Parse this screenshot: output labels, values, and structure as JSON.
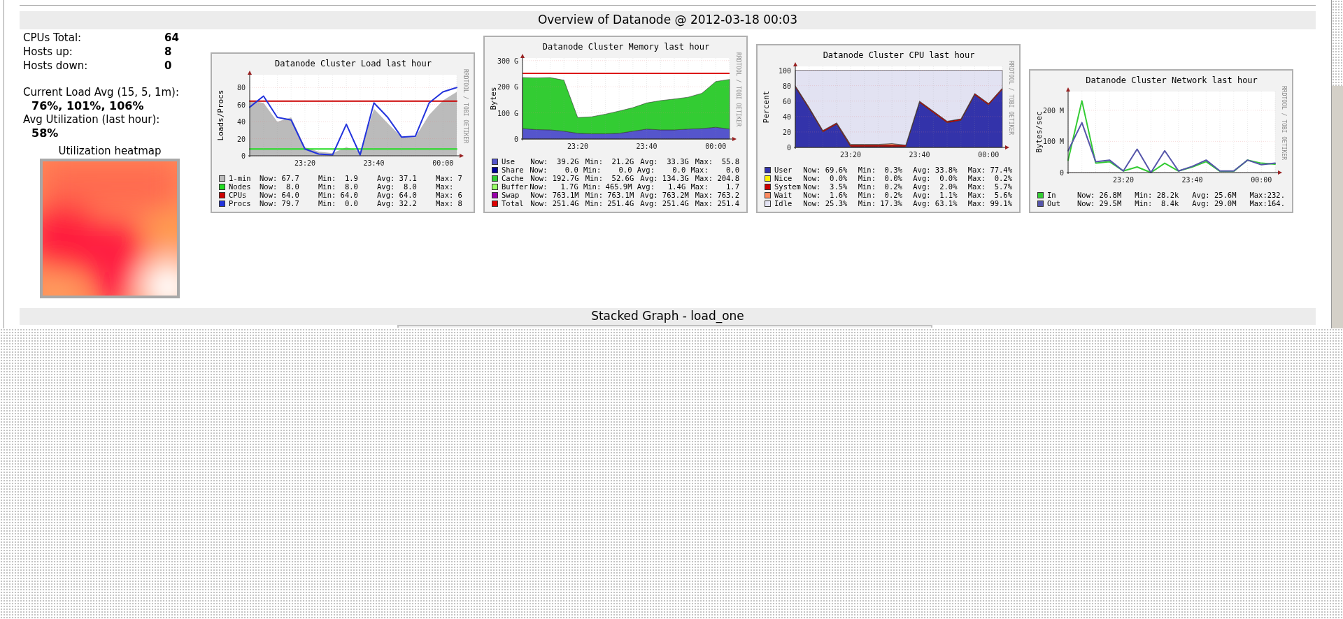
{
  "header": {
    "title": "Overview of Datanode @ 2012-03-18 00:03"
  },
  "summary": {
    "stats": [
      {
        "label": "CPUs Total:",
        "value": "64"
      },
      {
        "label": "Hosts up:",
        "value": "8"
      },
      {
        "label": "Hosts down:",
        "value": "0"
      }
    ],
    "load_avg": {
      "label": "Current Load Avg (15, 5, 1m):",
      "value": "76%, 101%, 106%"
    },
    "utilization": {
      "label": "Avg Utilization (last hour):",
      "value": "58%"
    },
    "heatmap": {
      "title": "Utilization heatmap"
    }
  },
  "charts": [
    {
      "credit": "RRDTOOL / TOBI OETIKER",
      "chart_data": {
        "type": "line",
        "title": "Datanode Cluster Load last hour",
        "ylabel": "Loads/Procs",
        "categories": [
          null,
          null,
          null,
          null,
          "23:20",
          null,
          null,
          null,
          null,
          "23:40",
          null,
          null,
          null,
          null,
          "00:00",
          null
        ],
        "series": [
          {
            "name": "1-min",
            "type": "area",
            "color": "#bbbbbb",
            "values": [
              65,
              62,
              40,
              45,
              10,
              5,
              3,
              10,
              5,
              55,
              38,
              22,
              22,
              48,
              65,
              75
            ]
          },
          {
            "name": "Nodes",
            "type": "line",
            "color": "#22dd22",
            "values": [
              8,
              8,
              8,
              8,
              8,
              8,
              8,
              8,
              8,
              8,
              8,
              8,
              8,
              8,
              8,
              8
            ]
          },
          {
            "name": "CPUs",
            "type": "line",
            "color": "#cc0000",
            "values": [
              64,
              64,
              64,
              64,
              64,
              64,
              64,
              64,
              64,
              64,
              64,
              64,
              64,
              64,
              64,
              64
            ]
          },
          {
            "name": "Procs",
            "type": "line",
            "color": "#2233dd",
            "values": [
              57,
              70,
              45,
              42,
              8,
              2,
              1,
              37,
              1,
              62,
              45,
              22,
              23,
              62,
              75,
              80
            ]
          }
        ],
        "ylim": [
          0,
          95
        ],
        "yticks": [
          0,
          20,
          40,
          60,
          80
        ],
        "grid": true
      },
      "legend": [
        {
          "now": "Now: 67.7",
          "min": "Min:  1.9",
          "avg": "Avg: 37.1",
          "max": "Max: 7"
        },
        {
          "now": "Now:  8.0",
          "min": "Min:  8.0",
          "avg": "Avg:  8.0",
          "max": "Max:"
        },
        {
          "now": "Now: 64.0",
          "min": "Min: 64.0",
          "avg": "Avg: 64.0",
          "max": "Max: 6"
        },
        {
          "now": "Now: 79.7",
          "min": "Min:  0.0",
          "avg": "Avg: 32.2",
          "max": "Max: 8"
        }
      ]
    },
    {
      "credit": "RRDTOOL / TOBI OETIKER",
      "chart_data": {
        "type": "area",
        "stacked": true,
        "title": "Datanode Cluster Memory last hour",
        "ylabel": "Bytes",
        "categories": [
          null,
          null,
          null,
          null,
          "23:20",
          null,
          null,
          null,
          null,
          "23:40",
          null,
          null,
          null,
          null,
          "00:00",
          null
        ],
        "series": [
          {
            "name": "Use",
            "type": "area",
            "color": "#5555cc",
            "values": [
              40,
              36,
              35,
              30,
              22,
              20,
              20,
              22,
              30,
              38,
              35,
              35,
              38,
              40,
              45,
              38
            ]
          },
          {
            "name": "Cache",
            "type": "area",
            "color": "#33cc33",
            "values": [
              195,
              198,
              200,
              195,
              60,
              65,
              75,
              85,
              90,
              100,
              112,
              118,
              122,
              135,
              175,
              190
            ]
          }
        ],
        "ref_lines": [
          {
            "axis": "y",
            "value": 251.4,
            "label": "Total",
            "color": "#dd0000"
          }
        ],
        "grid": true,
        "ylim": [
          0,
          310
        ],
        "yticks": [
          {
            "value": 0,
            "label": "0"
          },
          {
            "value": 100,
            "label": "100 G"
          },
          {
            "value": 200,
            "label": "200 G"
          },
          {
            "value": 300,
            "label": "300 G"
          }
        ]
      },
      "legend": [
        {
          "now": "Now:  39.2G",
          "min": "Min:  21.2G",
          "avg": "Avg:  33.3G",
          "max": "Max:  55.8"
        },
        {
          "name": "Share",
          "color": "#000099",
          "now": "Now:    0.0",
          "min": "Min:    0.0",
          "avg": "Avg:    0.0",
          "max": "Max:    0.0"
        },
        {
          "now": "Now: 192.7G",
          "min": "Min:  52.6G",
          "avg": "Avg: 134.3G",
          "max": "Max: 204.8"
        },
        {
          "name": "Buffer",
          "color": "#99ff66",
          "now": "Now:   1.7G",
          "min": "Min: 465.9M",
          "avg": "Avg:   1.4G",
          "max": "Max:    1.7"
        },
        {
          "name": "Swap",
          "color": "#9900aa",
          "now": "Now: 763.1M",
          "min": "Min: 763.1M",
          "avg": "Avg: 763.2M",
          "max": "Max: 763.2"
        },
        {
          "now": "Now: 251.4G",
          "min": "Min: 251.4G",
          "avg": "Avg: 251.4G",
          "max": "Max: 251.4"
        }
      ]
    },
    {
      "credit": "RRDTOOL / TOBI OETIKER",
      "chart_data": {
        "type": "area",
        "stacked": true,
        "title": "Datanode Cluster CPU last hour",
        "ylabel": "Percent",
        "categories": [
          null,
          null,
          null,
          null,
          "23:20",
          null,
          null,
          null,
          null,
          "23:40",
          null,
          null,
          null,
          null,
          "00:00",
          null
        ],
        "series": [
          {
            "name": "User",
            "type": "area",
            "color": "#3333aa",
            "values": [
              78,
              50,
              20,
              30,
              1,
              1,
              1,
              1,
              1,
              58,
              45,
              32,
              35,
              68,
              55,
              75
            ]
          },
          {
            "name": "System",
            "type": "area",
            "color": "#cc0000",
            "values": [
              2,
              2,
              2,
              2,
              2,
              2,
              2,
              2,
              2,
              2,
              2,
              2,
              2,
              2,
              2,
              2
            ]
          },
          {
            "name": "Wait",
            "type": "area",
            "color": "#ff8a60",
            "values": [
              0,
              0,
              0,
              0,
              1,
              1,
              1,
              2,
              0,
              0,
              0,
              0,
              0,
              0,
              0,
              0
            ]
          },
          {
            "name": "Idle",
            "type": "area",
            "color": "#e2e2f2",
            "values": [
              20,
              48,
              78,
              68,
              96,
              96,
              96,
              95,
              97,
              40,
              53,
              66,
              63,
              30,
              43,
              23
            ]
          }
        ],
        "ylim": [
          0,
          105
        ],
        "yticks": [
          0,
          20,
          40,
          60,
          80,
          100
        ],
        "grid": true
      },
      "legend": [
        {
          "now": "Now: 69.6%",
          "min": "Min:  0.3%",
          "avg": "Avg: 33.8%",
          "max": "Max: 77.4%"
        },
        {
          "name": "Nice",
          "color": "#ffee00",
          "now": "Now:  0.0%",
          "min": "Min:  0.0%",
          "avg": "Avg:  0.0%",
          "max": "Max:  0.2%"
        },
        {
          "now": "Now:  3.5%",
          "min": "Min:  0.2%",
          "avg": "Avg:  2.0%",
          "max": "Max:  5.7%"
        },
        {
          "now": "Now:  1.6%",
          "min": "Min:  0.2%",
          "avg": "Avg:  1.1%",
          "max": "Max:  5.6%"
        },
        {
          "now": "Now: 25.3%",
          "min": "Min: 17.3%",
          "avg": "Avg: 63.1%",
          "max": "Max: 99.1%"
        }
      ]
    },
    {
      "credit": "RRDTOOL / TOBI OETIKER",
      "chart_data": {
        "type": "line",
        "title": "Datanode Cluster Network last hour",
        "ylabel": "Bytes/sec",
        "categories": [
          null,
          null,
          null,
          null,
          "23:20",
          null,
          null,
          null,
          null,
          "23:40",
          null,
          null,
          null,
          null,
          "00:00",
          null
        ],
        "series": [
          {
            "name": "In",
            "type": "line",
            "color": "#33cc33",
            "values": [
              40,
              230,
              30,
              35,
              5,
              18,
              0,
              30,
              5,
              18,
              35,
              4,
              4,
              40,
              30,
              27
            ]
          },
          {
            "name": "Out",
            "type": "line",
            "color": "#5555aa",
            "values": [
              70,
              160,
              35,
              40,
              5,
              75,
              0,
              70,
              5,
              20,
              40,
              5,
              5,
              40,
              25,
              30
            ]
          }
        ],
        "ylim": [
          0,
          260
        ],
        "grid": true,
        "yticks": [
          {
            "value": 0,
            "label": "0"
          },
          {
            "value": 100,
            "label": "100 M"
          },
          {
            "value": 200,
            "label": "200 M"
          }
        ]
      },
      "legend": [
        {
          "now": "Now: 26.8M",
          "min": "Min: 28.2k",
          "avg": "Avg: 25.6M",
          "max": "Max:232."
        },
        {
          "now": "Now: 29.5M",
          "min": "Min:  8.4k",
          "avg": "Avg: 29.0M",
          "max": "Max:164."
        }
      ]
    }
  ],
  "stacked_section": {
    "title": "Stacked Graph - load_one"
  }
}
